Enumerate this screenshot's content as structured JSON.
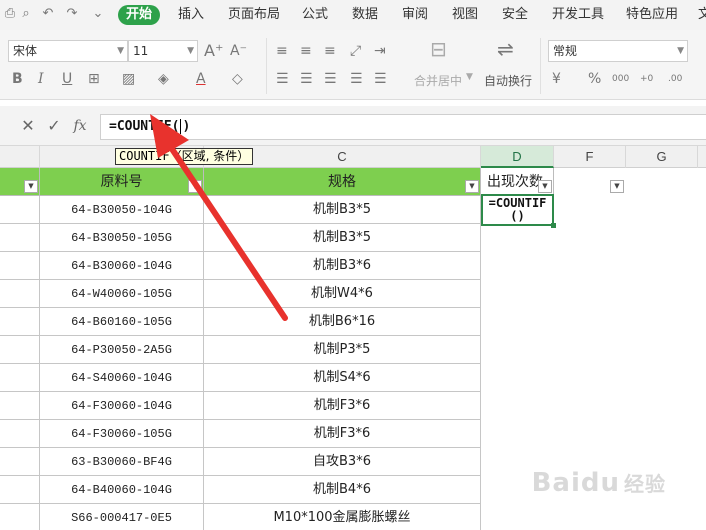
{
  "menu": {
    "tabs": [
      "开始",
      "插入",
      "页面布局",
      "公式",
      "数据",
      "审阅",
      "视图",
      "安全",
      "开发工具",
      "特色应用",
      "文"
    ],
    "active_index": 0
  },
  "ribbon": {
    "font_name": "宋体",
    "font_size": "11",
    "merge_center_label": "合并居中",
    "wrap_text_label": "自动换行",
    "number_format": "常规"
  },
  "formula_bar": {
    "cancel_icon": "close-icon",
    "confirm_icon": "check-icon",
    "fx_label": "fx",
    "formula_before_caret": "=COUNTIF(",
    "formula_after_caret": ")"
  },
  "tooltip": {
    "func": "COUNTIF",
    "args": "（区域, 条件）"
  },
  "columns": [
    "C",
    "D",
    "F",
    "G"
  ],
  "header_row": {
    "b": "原料号",
    "c": "规格",
    "d": "出现次数"
  },
  "active_cell": {
    "content": "=COUNTIF()"
  },
  "rows": [
    {
      "code": "64-B30050-104G",
      "spec": "机制B3*5"
    },
    {
      "code": "64-B30050-105G",
      "spec": "机制B3*5"
    },
    {
      "code": "64-B30060-104G",
      "spec": "机制B3*6"
    },
    {
      "code": "64-W40060-105G",
      "spec": "机制W4*6"
    },
    {
      "code": "64-B60160-105G",
      "spec": "机制B6*16"
    },
    {
      "code": "64-P30050-2A5G",
      "spec": "机制P3*5"
    },
    {
      "code": "64-S40060-104G",
      "spec": "机制S4*6"
    },
    {
      "code": "64-F30060-104G",
      "spec": "机制F3*6"
    },
    {
      "code": "64-F30060-105G",
      "spec": "机制F3*6"
    },
    {
      "code": "63-B30060-BF4G",
      "spec": "自攻B3*6"
    },
    {
      "code": "64-B40060-104G",
      "spec": "机制B4*6"
    },
    {
      "code": "S66-000417-0E5",
      "spec": "M10*100金属膨胀螺丝"
    }
  ],
  "watermark": {
    "brand": "Baidu",
    "sub": "经验"
  },
  "colors": {
    "accent": "#2da14a",
    "header_fill": "#7ecf4f",
    "arrow": "#e8322d"
  }
}
